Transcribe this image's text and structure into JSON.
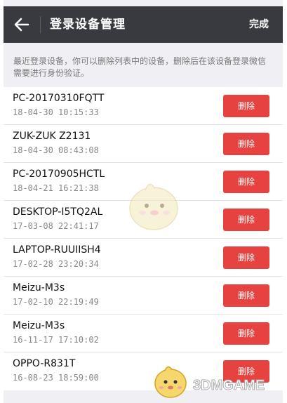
{
  "topbar": {
    "title": "登录设备管理",
    "done_label": "完成"
  },
  "hint": "最近登录设备，你可以删除列表中的设备，删除后在该设备登录微信需要进行身份验证。",
  "devices": [
    {
      "name": "PC-20170310FQTT",
      "time": "18-04-30 10:15:33",
      "delete_label": "删除"
    },
    {
      "name": "ZUK-ZUK Z2131",
      "time": "18-04-30 08:43:08",
      "delete_label": "删除"
    },
    {
      "name": "PC-20170905HCTL",
      "time": "18-04-21 16:21:38",
      "delete_label": "删除"
    },
    {
      "name": "DESKTOP-I5TQ2AL",
      "time": "17-03-08 22:41:17",
      "delete_label": "删除"
    },
    {
      "name": "LAPTOP-RUUIISH4",
      "time": "17-02-28 23:20:34",
      "delete_label": "删除"
    },
    {
      "name": "Meizu-M3s",
      "time": "17-02-10 22:19:49",
      "delete_label": "删除"
    },
    {
      "name": "Meizu-M3s",
      "time": "16-11-17 17:10:02",
      "delete_label": "删除"
    },
    {
      "name": "OPPO-R831T",
      "time": "16-08-23 18:59:00",
      "delete_label": "删除"
    }
  ],
  "watermark": {
    "text": "3DMGAME"
  },
  "icons": {
    "back": "arrow-left-icon",
    "mascot": "mascot-icon"
  },
  "colors": {
    "topbar": "#393a3f",
    "delete": "#e64340",
    "background": "#efeff4"
  }
}
